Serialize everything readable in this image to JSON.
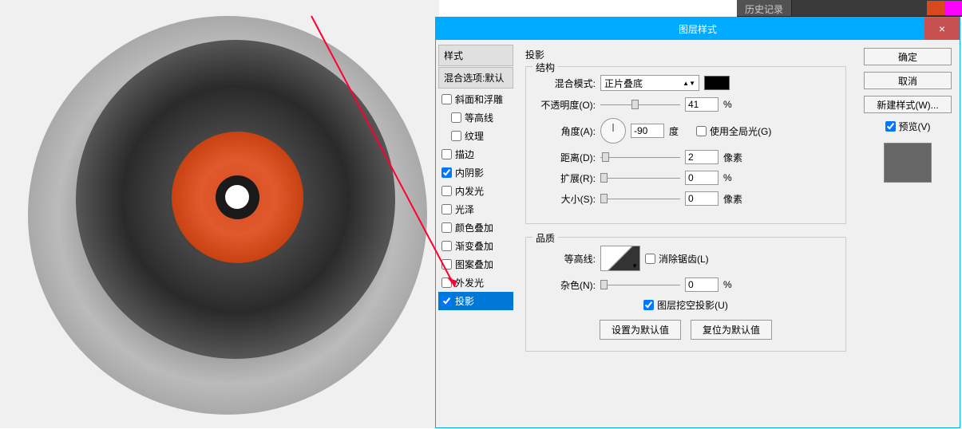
{
  "toolbar": {
    "history_tab": "历史记录"
  },
  "dialog": {
    "title": "图层样式",
    "close": "×",
    "styles_header": "样式",
    "blend_header": "混合选项:默认",
    "style_items": [
      {
        "label": "斜面和浮雕",
        "checked": false,
        "indent": false
      },
      {
        "label": "等高线",
        "checked": false,
        "indent": true
      },
      {
        "label": "纹理",
        "checked": false,
        "indent": true
      },
      {
        "label": "描边",
        "checked": false,
        "indent": false
      },
      {
        "label": "内阴影",
        "checked": true,
        "indent": false
      },
      {
        "label": "内发光",
        "checked": false,
        "indent": false
      },
      {
        "label": "光泽",
        "checked": false,
        "indent": false
      },
      {
        "label": "颜色叠加",
        "checked": false,
        "indent": false
      },
      {
        "label": "渐变叠加",
        "checked": false,
        "indent": false
      },
      {
        "label": "图案叠加",
        "checked": false,
        "indent": false
      },
      {
        "label": "外发光",
        "checked": false,
        "indent": false
      },
      {
        "label": "投影",
        "checked": true,
        "indent": false,
        "selected": true
      }
    ]
  },
  "settings": {
    "section_title": "投影",
    "structure_title": "结构",
    "blend_mode_label": "混合模式:",
    "blend_mode_value": "正片叠底",
    "opacity_label": "不透明度(O):",
    "opacity_value": "41",
    "opacity_unit": "%",
    "angle_label": "角度(A):",
    "angle_value": "-90",
    "angle_unit": "度",
    "global_light_label": "使用全局光(G)",
    "distance_label": "距离(D):",
    "distance_value": "2",
    "distance_unit": "像素",
    "spread_label": "扩展(R):",
    "spread_value": "0",
    "spread_unit": "%",
    "size_label": "大小(S):",
    "size_value": "0",
    "size_unit": "像素",
    "quality_title": "品质",
    "contour_label": "等高线:",
    "antialias_label": "消除锯齿(L)",
    "noise_label": "杂色(N):",
    "noise_value": "0",
    "noise_unit": "%",
    "knockout_label": "图层挖空投影(U)",
    "reset_default": "设置为默认值",
    "restore_default": "复位为默认值"
  },
  "right": {
    "ok": "确定",
    "cancel": "取消",
    "new_style": "新建样式(W)...",
    "preview": "预览(V)"
  }
}
